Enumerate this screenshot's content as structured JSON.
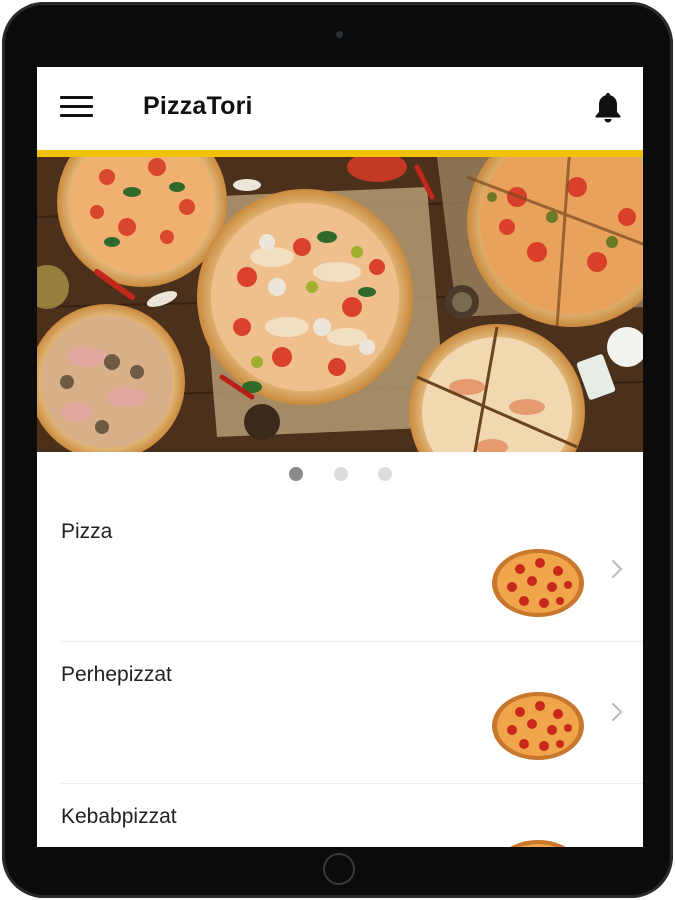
{
  "app": {
    "title": "PizzaTori",
    "accent_color": "#f2c200"
  },
  "header": {
    "menu_icon": "hamburger-menu-icon",
    "notifications_icon": "bell-icon"
  },
  "carousel": {
    "slide_count": 3,
    "active_index": 0,
    "image": "pizzas-on-wooden-table-photo"
  },
  "categories": [
    {
      "label": "Pizza",
      "thumb_icon": "pepperoni-pizza-icon"
    },
    {
      "label": "Perhepizzat",
      "thumb_icon": "pepperoni-pizza-icon"
    },
    {
      "label": "Kebabpizzat",
      "thumb_icon": "pepperoni-pizza-icon"
    }
  ]
}
